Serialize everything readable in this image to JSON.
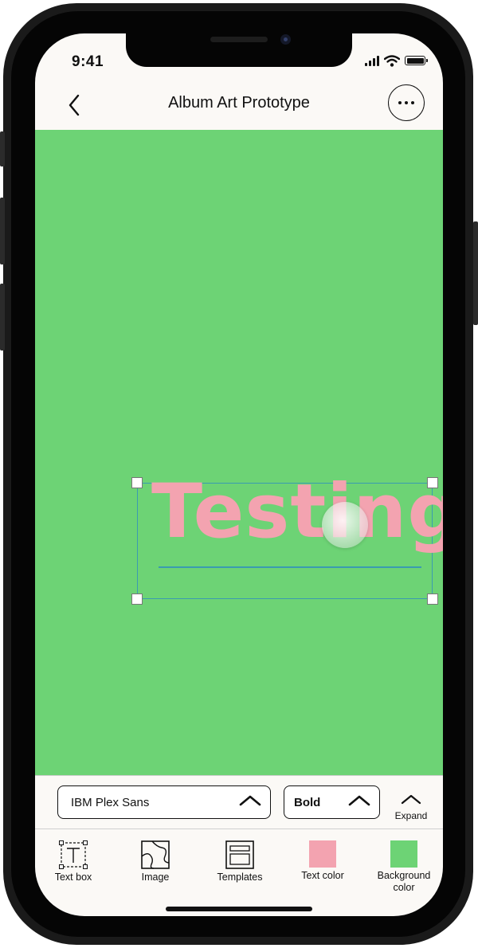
{
  "status_bar": {
    "time": "9:41"
  },
  "header": {
    "title": "Album Art Prototype"
  },
  "canvas": {
    "background_color": "#6dd375",
    "text_item": {
      "text": "Testing",
      "color": "#f3a3b0"
    }
  },
  "font_controls": {
    "font_family_value": "IBM Plex Sans",
    "font_weight_value": "Bold",
    "expand_label": "Expand"
  },
  "toolbar": {
    "text_box_label": "Text box",
    "image_label": "Image",
    "templates_label": "Templates",
    "text_color_label": "Text color",
    "background_color_label_line1": "Background",
    "background_color_label_line2": "color",
    "text_color_swatch": "#f3a3b0",
    "background_color_swatch": "#6dd375"
  },
  "icons": [
    "back-chevron-icon",
    "more-options-icon",
    "chevron-up-icon",
    "text-box-icon",
    "image-icon",
    "templates-icon"
  ]
}
